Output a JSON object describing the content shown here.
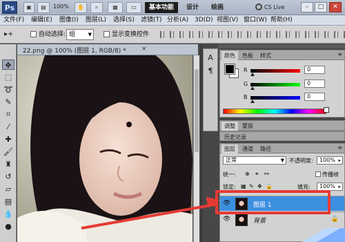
{
  "app": {
    "logo": "Ps",
    "zoom": "100%",
    "workspace_tabs": [
      "基本功能",
      "设计",
      "绘画"
    ],
    "cs_live": "CS Live",
    "window_buttons": [
      "–",
      "□",
      "✕"
    ]
  },
  "menu": [
    "文件(F)",
    "编辑(E)",
    "图像(I)",
    "图层(L)",
    "选择(S)",
    "滤镜(T)",
    "分析(A)",
    "3D(D)",
    "视图(V)",
    "窗口(W)",
    "帮助(H)"
  ],
  "options": {
    "auto_select_label": "自动选择:",
    "auto_select_value": "组",
    "show_transform_label": "显示变换控件"
  },
  "document": {
    "tab_title": "22.png @ 100% (图层 1, RGB/8) *",
    "close": "×"
  },
  "color_panel": {
    "tabs": [
      "颜色",
      "色板",
      "样式"
    ],
    "channels": [
      {
        "label": "R",
        "value": "0"
      },
      {
        "label": "G",
        "value": "0"
      },
      {
        "label": "B",
        "value": "0"
      }
    ]
  },
  "adjust_panel": {
    "tabs": [
      "调整",
      "蒙版"
    ]
  },
  "history": {
    "label": "历史记录"
  },
  "layers_panel": {
    "tabs": [
      "图层",
      "通道",
      "路径"
    ],
    "blend_mode": "正常",
    "opacity_label": "不透明度:",
    "opacity_value": "100%",
    "unify_label": "统一:",
    "propagate_label": "传播帧",
    "lock_label": "锁定:",
    "fill_label": "填充:",
    "fill_value": "100%",
    "layers": [
      {
        "name": "图层 1",
        "selected": true
      },
      {
        "name": "背景",
        "selected": false
      }
    ]
  },
  "colors": {
    "accent_selection": "#3d8fe0",
    "annotation": "#e53b35"
  }
}
